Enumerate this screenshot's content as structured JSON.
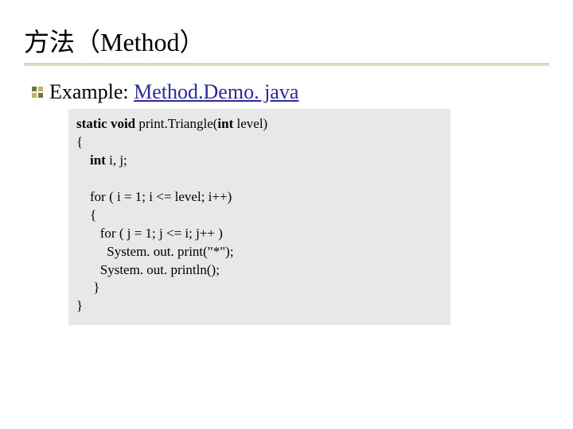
{
  "title": "方法（Method）",
  "bullet": {
    "label_prefix": "Example: ",
    "link_text": "Method.Demo. java"
  },
  "code": {
    "l1a": "static void ",
    "l1b": "print.Triangle(",
    "l1c": "int ",
    "l1d": "level)",
    "l2": "{",
    "l3a": "    int ",
    "l3b": "i, j;",
    "l4": "",
    "l5": "    for ( i = 1; i <= level; i++)",
    "l6": "    {",
    "l7": "       for ( j = 1; j <= i; j++ )",
    "l8": "         System. out. print(\"*\");",
    "l9": "       System. out. println();",
    "l10": "     }",
    "l11": "}"
  }
}
